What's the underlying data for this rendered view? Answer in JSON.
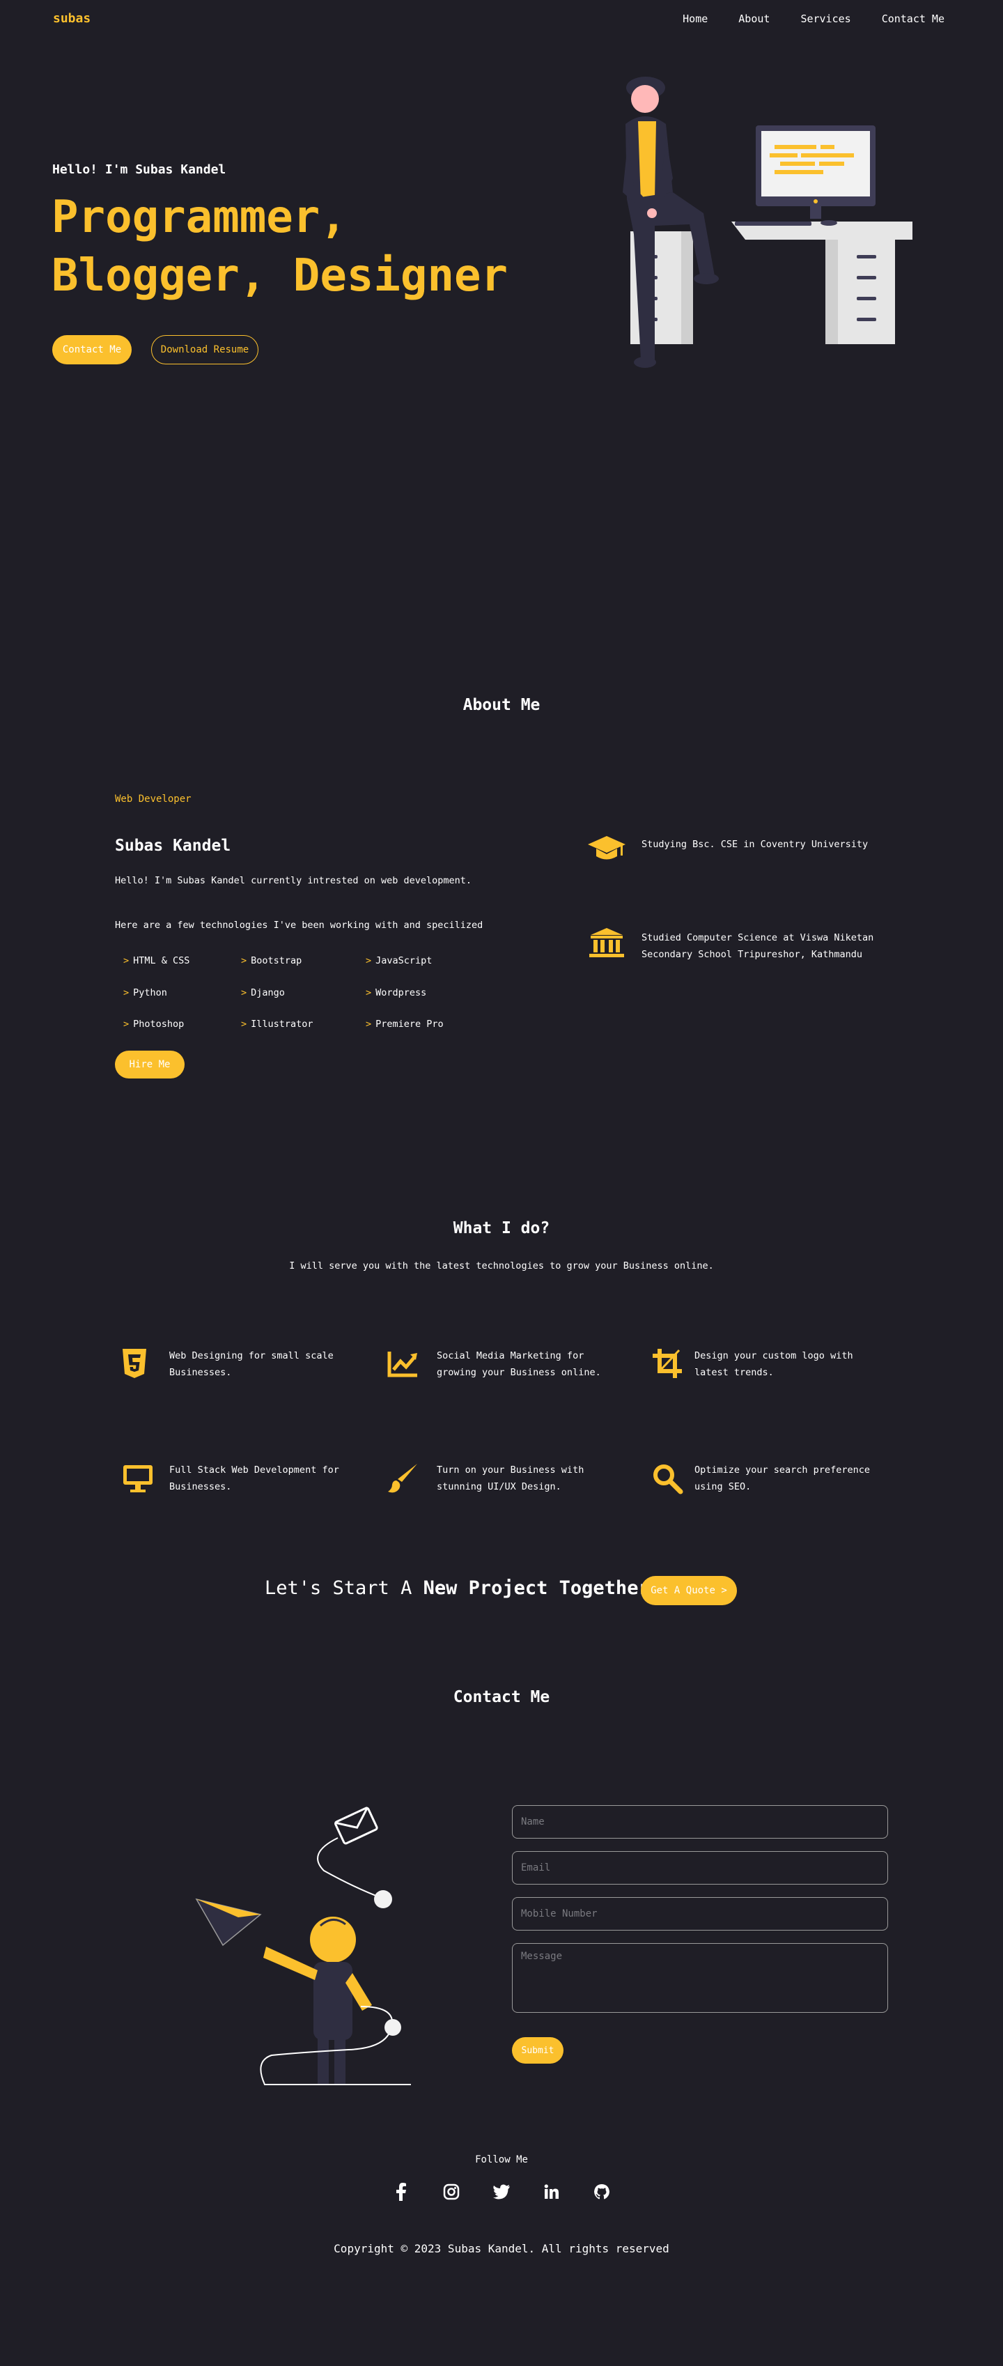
{
  "nav": {
    "brand": "subas",
    "links": [
      "Home",
      "About",
      "Services",
      "Contact Me"
    ]
  },
  "hero": {
    "greeting": "Hello! I'm Subas Kandel",
    "title": "Programmer, Blogger, Designer",
    "contact_button": "Contact Me",
    "resume_button": "Download Resume"
  },
  "about": {
    "section_title": "About Me",
    "role": "Web Developer",
    "name": "Subas Kandel",
    "intro": "Hello! I'm Subas Kandel currently intrested on web development.",
    "tech_intro": "Here are a few technologies I've been working with and specilized",
    "technologies": [
      "HTML & CSS",
      "Bootstrap",
      "JavaScript",
      "Python",
      "Django",
      "Wordpress",
      "Photoshop",
      "Illustrator",
      "Premiere Pro"
    ],
    "hire_button": "Hire Me",
    "education": [
      {
        "icon": "graduation-cap-icon",
        "text": "Studying Bsc. CSE in Coventry University"
      },
      {
        "icon": "university-icon",
        "text": "Studied Computer Science at Viswa Niketan Secondary School Tripureshor, Kathmandu"
      }
    ]
  },
  "services": {
    "section_title": "What I do?",
    "subtitle": "I will serve you with the latest technologies to grow your Business online.",
    "items": [
      {
        "icon": "html5-icon",
        "text": "Web Designing for small scale Businesses."
      },
      {
        "icon": "chart-line-icon",
        "text": "Social Media Marketing for growing your Business online."
      },
      {
        "icon": "crop-icon",
        "text": "Design your custom logo with latest trends."
      },
      {
        "icon": "desktop-icon",
        "text": "Full Stack Web Development for Businesses."
      },
      {
        "icon": "paint-brush-icon",
        "text": "Turn on your Business with stunning UI/UX Design."
      },
      {
        "icon": "search-icon",
        "text": "Optimize your search preference using SEO."
      }
    ]
  },
  "cta": {
    "lead": "Let's Start A",
    "strong": "New Project Together",
    "button": "Get A Quote >"
  },
  "contact": {
    "section_title": "Contact Me",
    "name_placeholder": "Name",
    "email_placeholder": "Email",
    "mobile_placeholder": "Mobile Number",
    "message_placeholder": "Message",
    "submit": "Submit"
  },
  "footer": {
    "follow": "Follow Me",
    "socials": [
      "facebook-icon",
      "instagram-icon",
      "twitter-icon",
      "linkedin-icon",
      "github-icon"
    ],
    "copyright": "Copyright © 2023 Subas Kandel. All rights reserved"
  },
  "colors": {
    "background": "#1f1e26",
    "accent": "#fbc02d",
    "text": "#ffffff"
  }
}
